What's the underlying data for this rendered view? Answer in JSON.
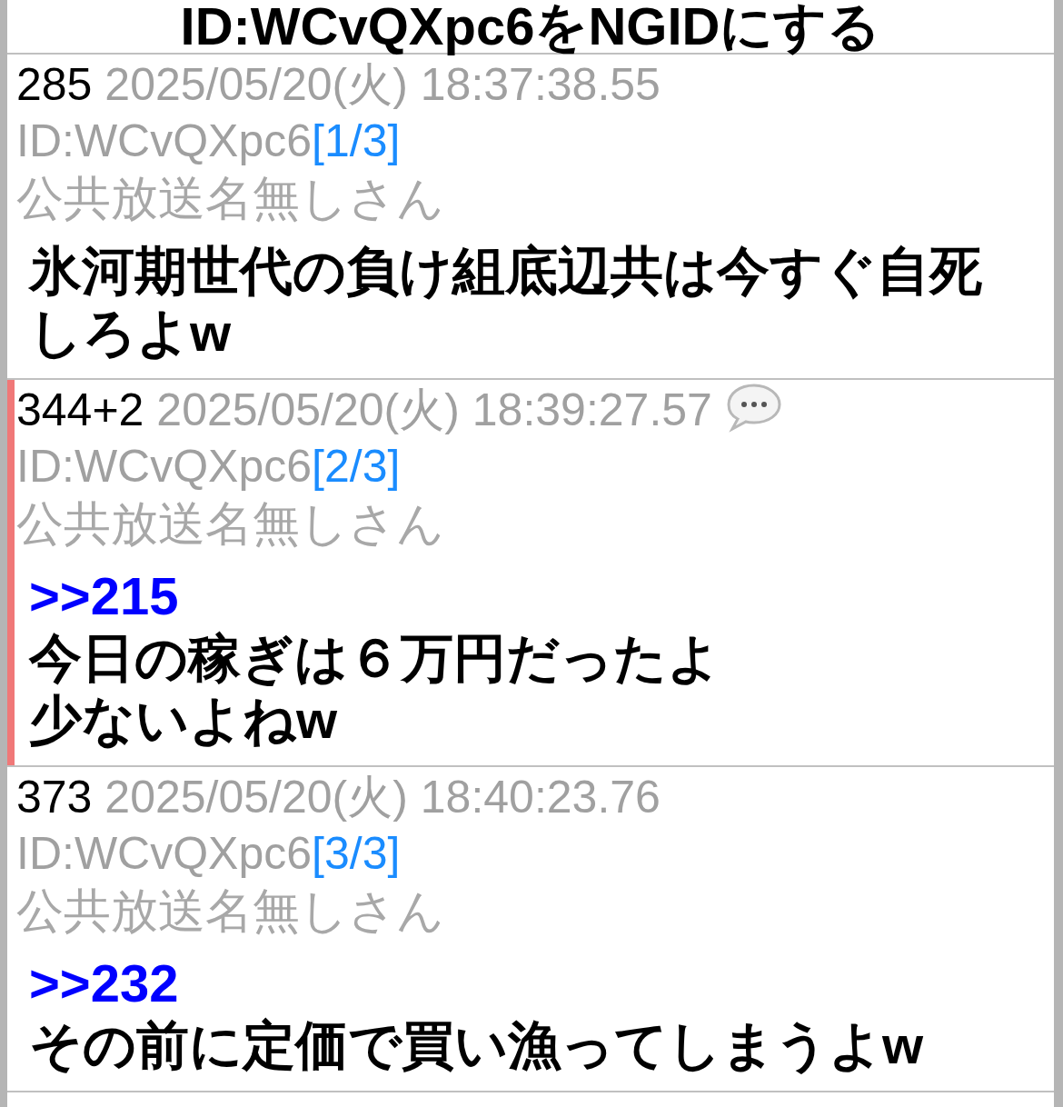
{
  "title": "ID:WCvQXpc6をNGIDにする",
  "posts": [
    {
      "number": "285",
      "date": "2025/05/20(火) 18:37:38.55",
      "has_bubble_icon": false,
      "id": "ID:WCvQXpc6",
      "count": "[1/3]",
      "name": "公共放送名無しさん",
      "marked": false,
      "lines": [
        "氷河期世代の負け組底辺共は今すぐ自死しろよw"
      ]
    },
    {
      "number": "344+2",
      "date": "2025/05/20(火) 18:39:27.57",
      "has_bubble_icon": true,
      "id": "ID:WCvQXpc6",
      "count": "[2/3]",
      "name": "公共放送名無しさん",
      "marked": true,
      "anchor": ">>215",
      "lines": [
        "今日の稼ぎは６万円だったよ",
        "少ないよねw"
      ]
    },
    {
      "number": "373",
      "date": "2025/05/20(火) 18:40:23.76",
      "has_bubble_icon": false,
      "id": "ID:WCvQXpc6",
      "count": "[3/3]",
      "name": "公共放送名無しさん",
      "marked": false,
      "anchor": ">>232",
      "lines": [
        "その前に定価で買い漁ってしまうよw"
      ]
    }
  ]
}
